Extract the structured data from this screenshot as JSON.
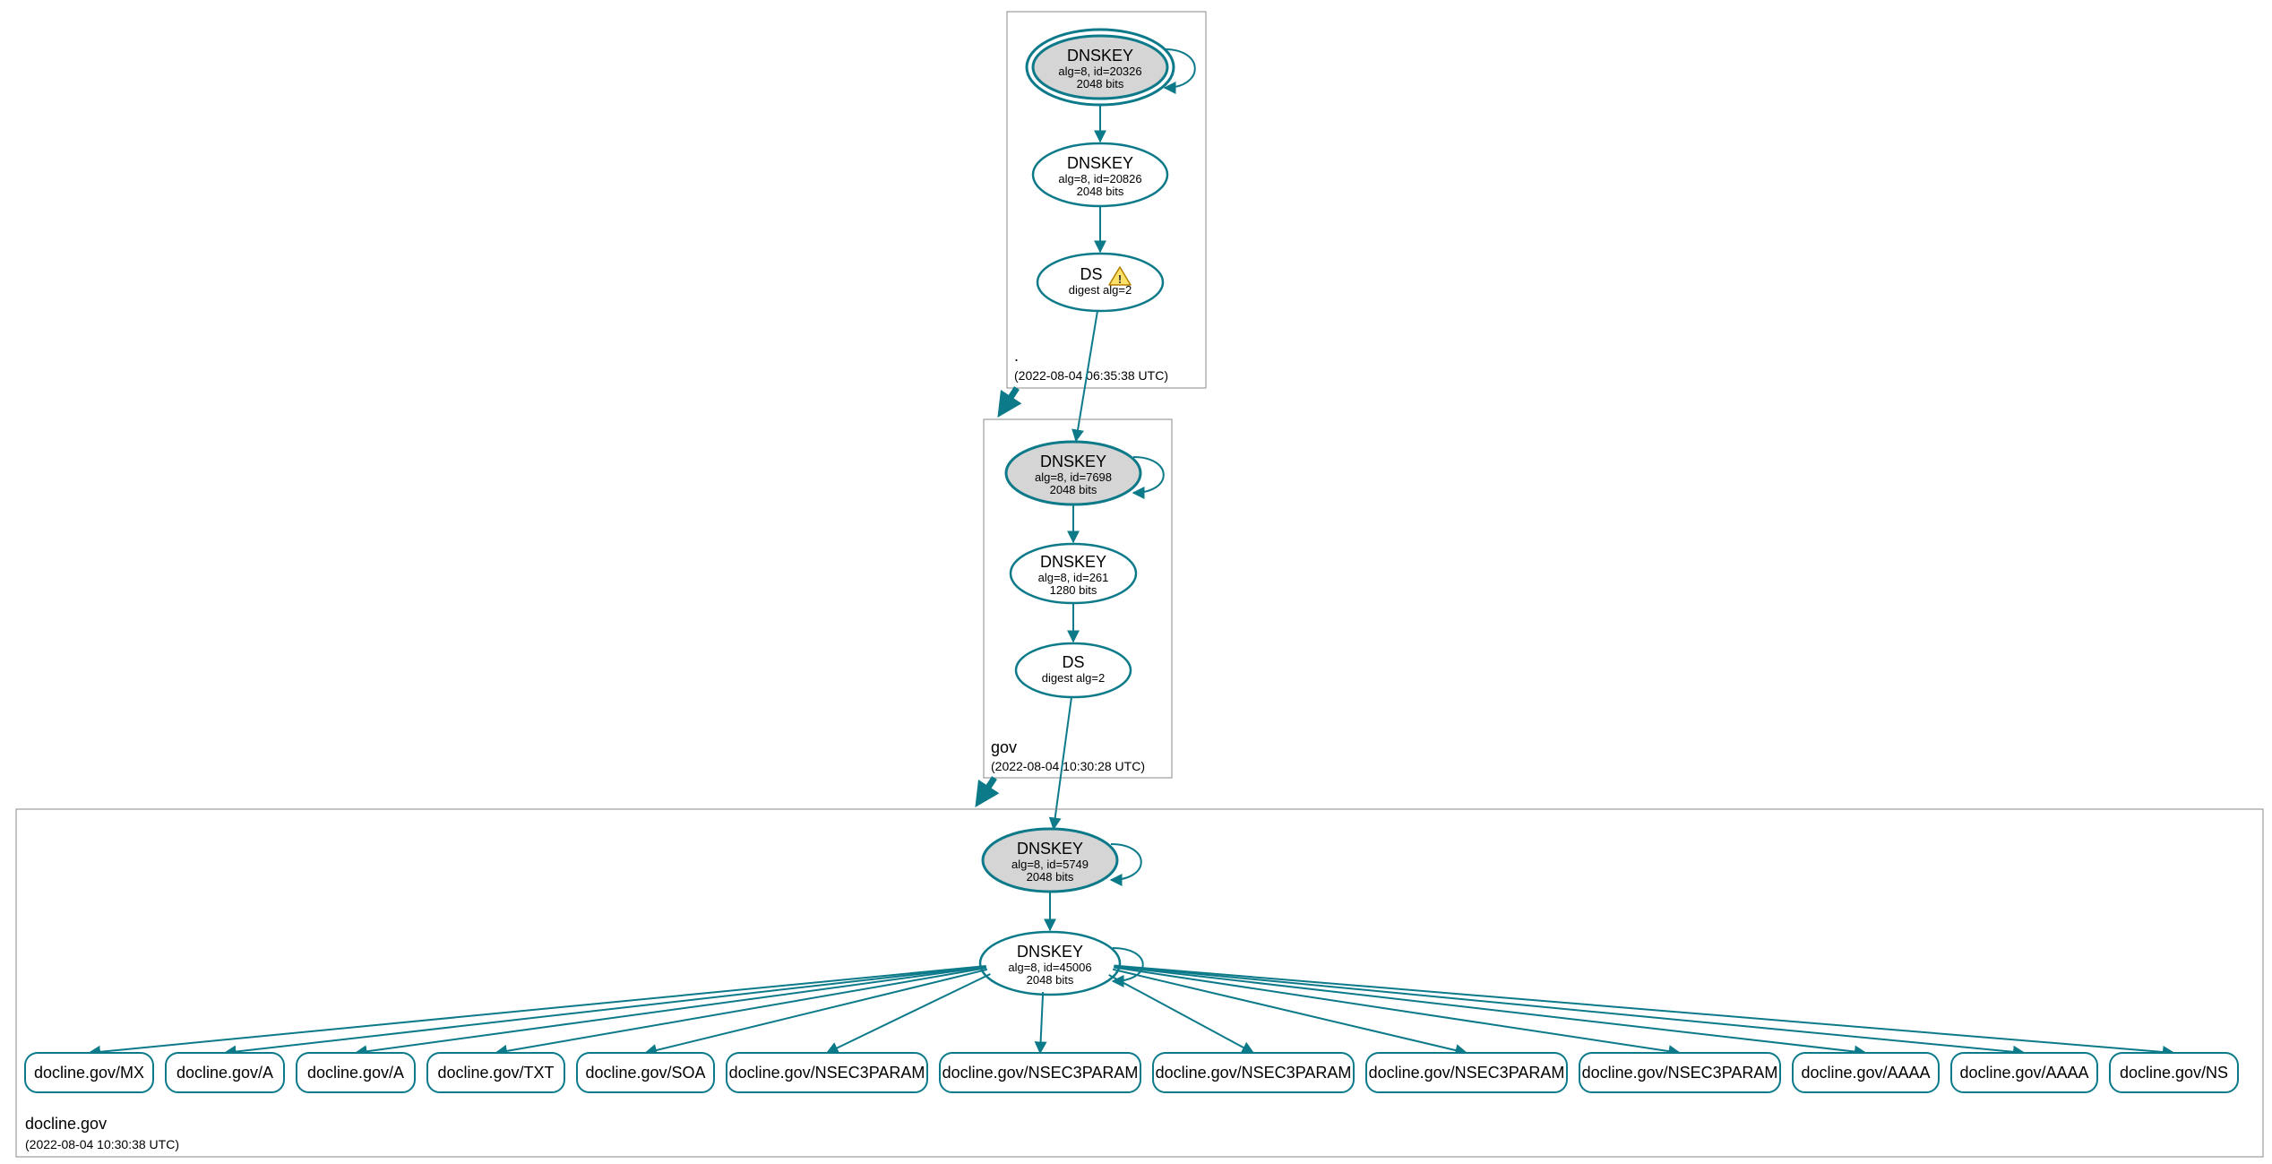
{
  "colors": {
    "stroke": "#0d7a8a",
    "ksk_fill": "#d5d5d5",
    "box_stroke": "#888888"
  },
  "zones": {
    "root": {
      "label": ".",
      "timestamp": "(2022-08-04 06:35:38 UTC)",
      "nodes": {
        "ksk": {
          "title": "DNSKEY",
          "line2": "alg=8, id=20326",
          "line3": "2048 bits"
        },
        "zsk": {
          "title": "DNSKEY",
          "line2": "alg=8, id=20826",
          "line3": "2048 bits"
        },
        "ds": {
          "title": "DS",
          "line2": "digest alg=2",
          "warning": true
        }
      }
    },
    "gov": {
      "label": "gov",
      "timestamp": "(2022-08-04 10:30:28 UTC)",
      "nodes": {
        "ksk": {
          "title": "DNSKEY",
          "line2": "alg=8, id=7698",
          "line3": "2048 bits"
        },
        "zsk": {
          "title": "DNSKEY",
          "line2": "alg=8, id=261",
          "line3": "1280 bits"
        },
        "ds": {
          "title": "DS",
          "line2": "digest alg=2"
        }
      }
    },
    "docline": {
      "label": "docline.gov",
      "timestamp": "(2022-08-04 10:30:38 UTC)",
      "nodes": {
        "ksk": {
          "title": "DNSKEY",
          "line2": "alg=8, id=5749",
          "line3": "2048 bits"
        },
        "zsk": {
          "title": "DNSKEY",
          "line2": "alg=8, id=45006",
          "line3": "2048 bits"
        }
      },
      "rrsets": [
        "docline.gov/MX",
        "docline.gov/A",
        "docline.gov/A",
        "docline.gov/TXT",
        "docline.gov/SOA",
        "docline.gov/NSEC3PARAM",
        "docline.gov/NSEC3PARAM",
        "docline.gov/NSEC3PARAM",
        "docline.gov/NSEC3PARAM",
        "docline.gov/NSEC3PARAM",
        "docline.gov/AAAA",
        "docline.gov/AAAA",
        "docline.gov/NS"
      ]
    }
  }
}
